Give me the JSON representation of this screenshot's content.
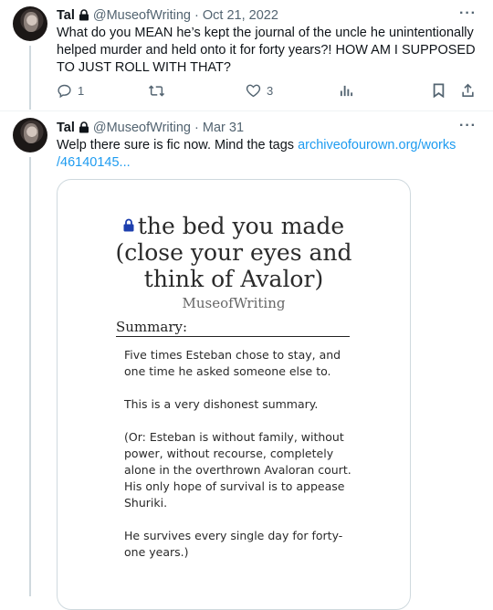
{
  "tweets": [
    {
      "name": "Tal",
      "handle": "@MuseofWriting",
      "separator": "·",
      "date": "Oct 21, 2022",
      "more": "···",
      "text": "What do you MEAN he’s kept the journal of the uncle he unintentionally helped murder and held onto it for forty years?! HOW AM I SUPPOSED TO JUST ROLL WITH THAT?",
      "reply_count": "1",
      "like_count": "3",
      "icons": [
        "avatar",
        "lock-icon",
        "reply-icon",
        "retweet-icon",
        "like-icon",
        "views-icon",
        "bookmark-icon",
        "share-icon"
      ]
    },
    {
      "name": "Tal",
      "handle": "@MuseofWriting",
      "separator": "·",
      "date": "Mar 31",
      "more": "···",
      "text": "Welp there sure is fic now. Mind the tags",
      "link_line1": "archiveofourown.org/works",
      "link_line2": "/46140145..."
    }
  ],
  "card": {
    "title_line1": "the bed you made",
    "title_line2": "(close your eyes and",
    "title_line3": "think of Avalor)",
    "author": "MuseofWriting",
    "summary_heading": "Summary:",
    "summary_paragraphs": [
      "Five times Esteban chose to stay, and one time he asked someone else to.",
      "This is a very dishonest summary.",
      "(Or: Esteban is without family, without power, without recourse, completely alone in the overthrown Avaloran court. His only hope of survival is to appease Shuriki.",
      "He survives every single day for forty-one years.)"
    ],
    "accent_color": "#1d3fae"
  },
  "colors": {
    "link": "#1d9bf0",
    "muted": "#536471",
    "text": "#0f1419",
    "border": "#cfd9de"
  }
}
